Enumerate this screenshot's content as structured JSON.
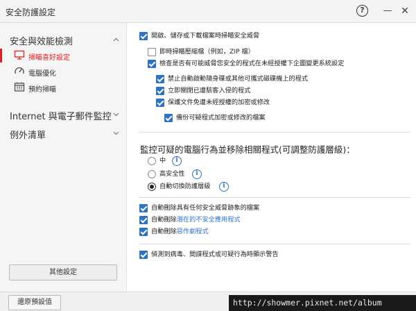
{
  "window": {
    "title": "安全防護設定",
    "help_glyph": "?",
    "minimize_glyph": "—",
    "close_glyph": "✕"
  },
  "sidebar": {
    "section1": {
      "label": "安全與效能檢測",
      "expanded": true
    },
    "items": [
      {
        "label": "掃瞄喜好設定",
        "icon": "monitor-icon",
        "active": true
      },
      {
        "label": "電腦優化",
        "icon": "gauge-icon",
        "active": false
      },
      {
        "label": "預約掃瞄",
        "icon": "calendar-icon",
        "active": false
      }
    ],
    "section2": {
      "label": "Internet 與電子郵件監控",
      "expanded": false
    },
    "section3": {
      "label": "例外清單",
      "expanded": false
    },
    "other_settings_label": "其他設定"
  },
  "options": {
    "scan_on_open": {
      "label": "開啟、儲存或下載檔案時掃瞄安全威脅",
      "checked": true
    },
    "scan_zip": {
      "label": "即時掃瞄壓縮檔（例如，ZIP 檔）",
      "checked": false
    },
    "check_unauthorized": {
      "label": "檢查是否有可能威脅您安全的程式在未經授權下企圖變更系統設定",
      "checked": true
    },
    "block_autorun": {
      "label": "禁止自動啟動隨身碟或其他可攜式磁碟機上的程式",
      "checked": true
    },
    "close_infected": {
      "label": "立即關閉已遭駭客入侵的程式",
      "checked": true
    },
    "protect_documents": {
      "label": "保護文件免遭未經授權的加密或修改",
      "checked": true
    },
    "backup_files": {
      "label": "備份可疑程式加密或修改的檔案",
      "checked": true
    }
  },
  "monitor": {
    "title": "監控可疑的電腦行為並移除相關程式(可調整防護層級)：",
    "levels": [
      {
        "label": "中",
        "selected": false
      },
      {
        "label": "高安全性",
        "selected": false
      },
      {
        "label": "自動切換防護層級",
        "selected": true
      }
    ],
    "info_glyph": "i"
  },
  "auto_delete": {
    "threat_files": {
      "prefix": "自動刪除具有任何安全威脅跡象的檔案",
      "highlight": "",
      "checked": true
    },
    "unsafe_apps": {
      "prefix": "自動刪除",
      "highlight": "潛在的不安全應用程式",
      "checked": true
    },
    "pranks": {
      "prefix": "自動刪除",
      "highlight": "惡作劇程式",
      "checked": true
    }
  },
  "warn_option": {
    "label": "偵測到病毒、間諜程式或可疑行為時顯示警告",
    "checked": true
  },
  "footer": {
    "restore_label": "還原預設值",
    "watermark": "http://showmer.pixnet.net/album"
  },
  "colors": {
    "accent": "#2f72c4",
    "active": "#e02020"
  }
}
